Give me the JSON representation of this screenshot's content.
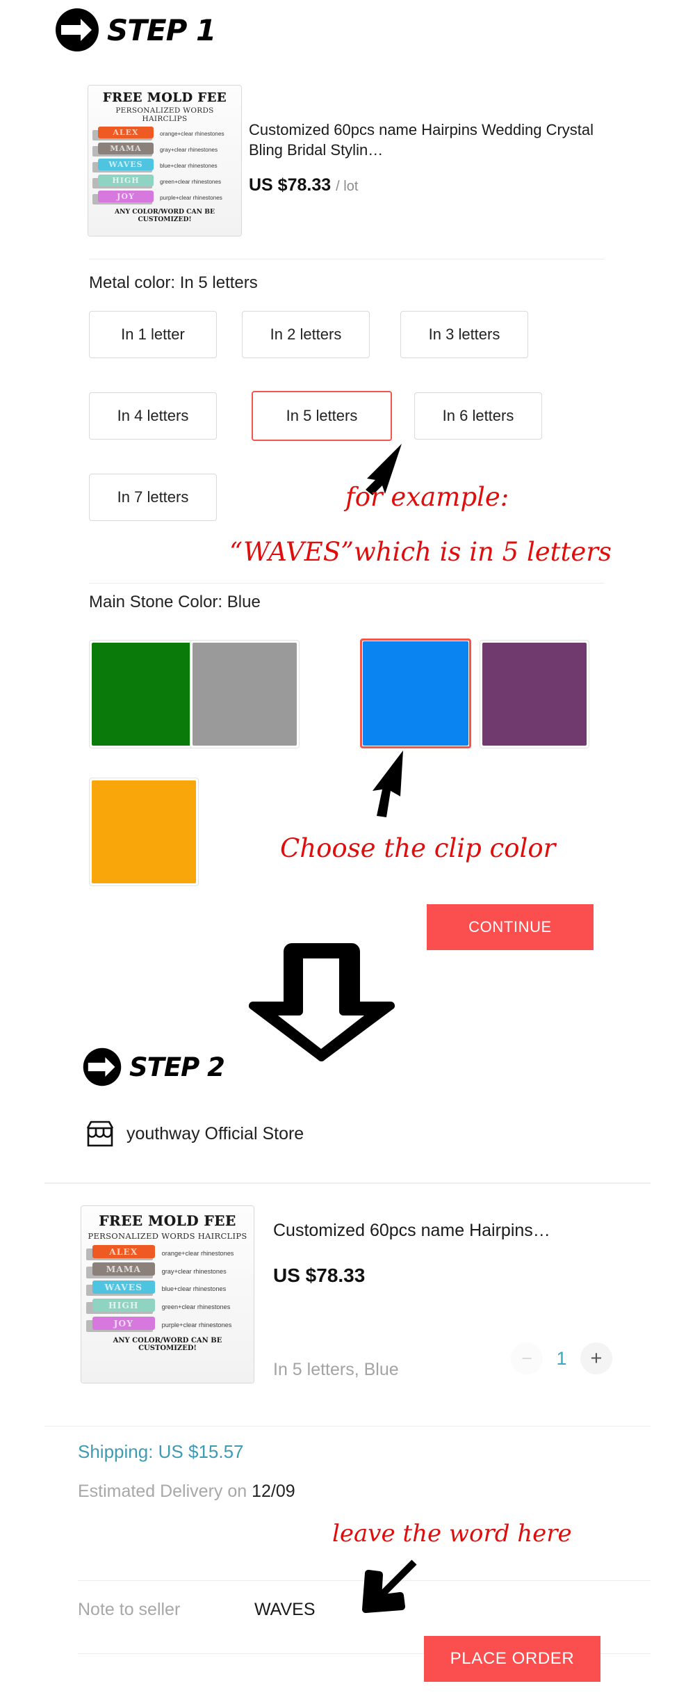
{
  "steps": {
    "step1_label": "STEP 1",
    "step2_label": "STEP 2"
  },
  "product": {
    "title": "Customized 60pcs name Hairpins Wedding Crystal Bling Bridal Stylin…",
    "price_amount": "US $78.33",
    "price_unit": "/ lot"
  },
  "thumbnail": {
    "headline": "FREE MOLD FEE",
    "subhead": "PERSONALIZED WORDS HAIRCLIPS",
    "footer": "ANY COLOR/WORD CAN BE CUSTOMIZED!",
    "rows": [
      {
        "word": "ALEX",
        "label": "orange+clear rhinestones",
        "color": "#ee5a22"
      },
      {
        "word": "MAMA",
        "label": "gray+clear rhinestones",
        "color": "#8b817a"
      },
      {
        "word": "WAVES",
        "label": "blue+clear rhinestones",
        "color": "#4ec4e0"
      },
      {
        "word": "HIGH",
        "label": "green+clear rhinestones",
        "color": "#8fd3c2"
      },
      {
        "word": "JOY",
        "label": "purple+clear rhinestones",
        "color": "#d678dd"
      }
    ]
  },
  "metal_color": {
    "label": "Metal color: In 5 letters",
    "selected": "In 5 letters",
    "options": [
      "In 1 letter",
      "In 2 letters",
      "In 3 letters",
      "In 4 letters",
      "In 5 letters",
      "In 6 letters",
      "In 7 letters"
    ]
  },
  "stone_color": {
    "label": "Main Stone Color: Blue",
    "selected": "Blue",
    "swatches": [
      {
        "name": "Green",
        "hex": "#0a7a0a",
        "selected": false
      },
      {
        "name": "Gray",
        "hex": "#9a9a9a",
        "selected": false
      },
      {
        "name": "Blue",
        "hex": "#0a84f0",
        "selected": true
      },
      {
        "name": "Purple",
        "hex": "#703a6e",
        "selected": false
      },
      {
        "name": "Orange",
        "hex": "#f9a60b",
        "selected": false
      }
    ]
  },
  "buttons": {
    "continue": "CONTINUE",
    "place_order": "PLACE ORDER"
  },
  "store": {
    "name": "youthway Official Store",
    "icon": "store-icon"
  },
  "order_item": {
    "title": "Customized 60pcs name Hairpins…",
    "price": "US $78.33",
    "variant": "In 5 letters, Blue",
    "quantity": "1",
    "minus": "−",
    "plus": "+"
  },
  "summary": {
    "shipping": "Shipping: US $15.57",
    "eta_prefix": "Estimated Delivery on ",
    "eta_date": "12/09",
    "note_label": "Note to seller",
    "note_value": "WAVES"
  },
  "annotations": {
    "example_line1": "for example:",
    "example_line2": "“WAVES”which is in 5 letters",
    "choose_clip": "Choose the clip color",
    "leave_word": "leave the word here",
    "color": "#e00d0d"
  },
  "theme": {
    "accent_red": "#fb4e4e",
    "select_red": "#f2564a",
    "link_teal": "#3f9ab4",
    "qty_teal": "#38a9c4"
  }
}
